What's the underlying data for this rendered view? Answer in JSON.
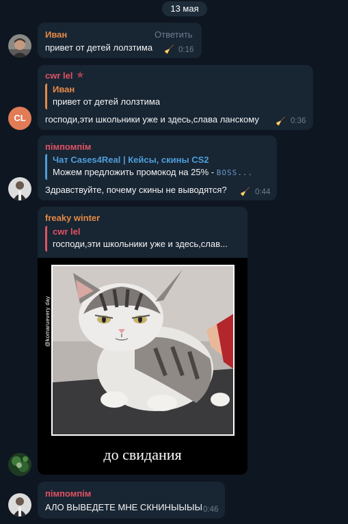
{
  "date_separator": "13 мая",
  "reply_action": "Ответить",
  "colors": {
    "background": "#0e1621",
    "bubble": "#182533",
    "ivan_name": "#e48a47",
    "cwr_name": "#e05263",
    "pimpompim_name": "#e05263",
    "freaky_name": "#e48a47",
    "chat_quote": "#4e9edb",
    "initials_avatar": "#e17c57"
  },
  "messages": [
    {
      "sender": "Иван",
      "text": "привет от детей лолзтима",
      "time": "0:16",
      "avatar": "photo"
    },
    {
      "sender": "cwr lel",
      "badge": "star-icon",
      "avatar_initials": "CL",
      "quote": {
        "name": "Иван",
        "text": "привет от детей лолзтима"
      },
      "text": "господи,эти школьники уже и здесь,слава ланскому",
      "time": "0:36"
    },
    {
      "sender": "пімпомпім",
      "quote": {
        "name": "Чат Cases4Real | Кейсы, скины CS2",
        "text": "Можем предложить промокод на 25% -",
        "extra": "BOSS..."
      },
      "text": "Здравствуйте, почему скины не выводятся?",
      "time": "0:44"
    },
    {
      "sender": "freaky winter",
      "quote": {
        "name": "cwr lel",
        "text": "господи,эти школьники уже и здесь,слав..."
      },
      "sticker": {
        "watermark": "@komaruevery day",
        "caption": "до свидания"
      }
    },
    {
      "sender": "пімпомпім",
      "text": "АЛО ВЫВЕДЕТЕ МНЕ СКНИНЫЫЫЫ",
      "time": "0:46"
    }
  ]
}
